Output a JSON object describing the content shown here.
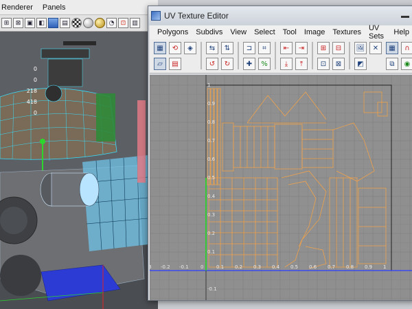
{
  "maya": {
    "menus": [
      "Renderer",
      "Panels"
    ],
    "channel_values": [
      "0",
      "0",
      "218",
      "418",
      "0"
    ],
    "toolbar_icons": [
      "grid-icon",
      "wireframe-icon",
      "texture-icon",
      "shaded-icon",
      "cube-icon",
      "sphere-icon",
      "checker-icon",
      "gold-sphere-icon",
      "render-icon",
      "red-icon"
    ]
  },
  "uv_editor": {
    "title": "UV Texture Editor",
    "menus": [
      "Polygons",
      "Subdivs",
      "View",
      "Select",
      "Tool",
      "Image",
      "Textures",
      "UV Sets",
      "Help"
    ],
    "x_ticks": [
      "-0.3",
      "-0.2",
      "-0.1",
      "0",
      "0.1",
      "0.2",
      "0.3",
      "0.4",
      "0.5",
      "0.6",
      "0.7",
      "0.8",
      "0.9",
      "1"
    ],
    "y_ticks": [
      "1",
      "0.9",
      "0.8",
      "0.7",
      "0.6",
      "0.5",
      "0.4",
      "0.3",
      "0.2",
      "0.1",
      "-0.1"
    ],
    "colors": {
      "uv_wire": "#f0a24a",
      "grid_bg": "#909090",
      "u_axis": "#2b3cff",
      "v_axis": "#2bd12b"
    }
  }
}
